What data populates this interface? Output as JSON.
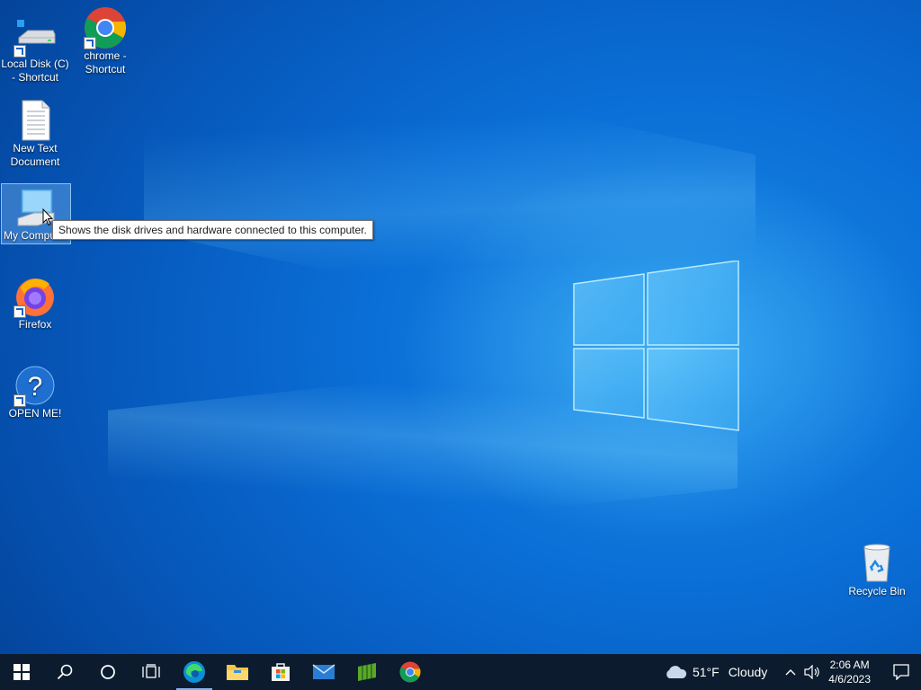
{
  "desktop": {
    "icons": [
      {
        "label": "Local Disk (C) - Shortcut"
      },
      {
        "label": "chrome - Shortcut"
      },
      {
        "label": "New Text Document"
      },
      {
        "label": "My Computer"
      },
      {
        "label": "Firefox"
      },
      {
        "label": "OPEN ME!"
      },
      {
        "label": "Recycle Bin"
      }
    ],
    "tooltip": "Shows the disk drives and hardware connected to this computer."
  },
  "taskbar": {
    "pinned": [
      "start-icon",
      "search-icon",
      "cortana-icon",
      "task-view-icon",
      "edge-icon",
      "file-explorer-icon",
      "store-icon",
      "mail-icon",
      "minecraft-icon",
      "chrome-icon"
    ],
    "weather": {
      "temp": "51°F",
      "condition": "Cloudy"
    },
    "clock": {
      "time": "2:06 AM",
      "date": "4/6/2023"
    }
  },
  "colors": {
    "accent": "#0a6ed6",
    "taskbar": "#0c1c2e"
  }
}
